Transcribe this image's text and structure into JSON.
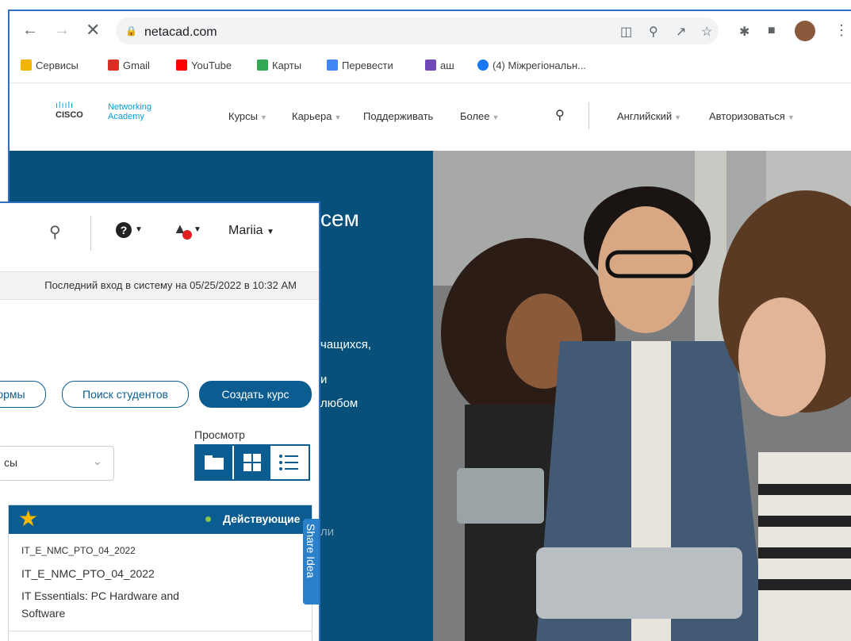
{
  "browser": {
    "url": "netacad.com",
    "bookmarks": [
      {
        "label": "Сервисы",
        "color": "#f2b400"
      },
      {
        "label": "Gmail",
        "color": "#d93025"
      },
      {
        "label": "YouTube",
        "color": "#ff0000"
      },
      {
        "label": "Карты",
        "color": "#34a853"
      },
      {
        "label": "Перевести",
        "color": "#4285f4"
      },
      {
        "label": "аш",
        "color": "#7248b9"
      },
      {
        "label": "(4) Міжрегіональн...",
        "color": "#1877f2"
      }
    ]
  },
  "site": {
    "logo_top": "Networking",
    "logo_bottom": "Academy",
    "logo_brand": "CISCO",
    "nav": [
      "Курсы",
      "Карьера",
      "Поддерживать",
      "Более"
    ],
    "language": "Английский",
    "login": "Авторизоваться",
    "hero_fragments": [
      "сем",
      "чащихся,",
      "и",
      "любом",
      "ли"
    ]
  },
  "app": {
    "user": "Mariia",
    "last_login": "Последний вход в систему на 05/25/2022 в 10:32 AM",
    "buttons": {
      "forms": "ормы",
      "search_students": "Поиск студентов",
      "create_course": "Создать курс"
    },
    "view_label": "Просмотр",
    "select_value": "сы",
    "card": {
      "status": "Действующие",
      "code_small": "IT_E_NMC_PTO_04_2022",
      "code": "IT_E_NMC_PTO_04_2022",
      "title_line1": "IT Essentials: PC Hardware and",
      "title_line2": "Software"
    },
    "share_idea": "Share Idea"
  },
  "colors": {
    "accent": "#0b5c91",
    "hero": "#07507a",
    "notification": "#e02020",
    "status_dot": "#8bc34a"
  }
}
